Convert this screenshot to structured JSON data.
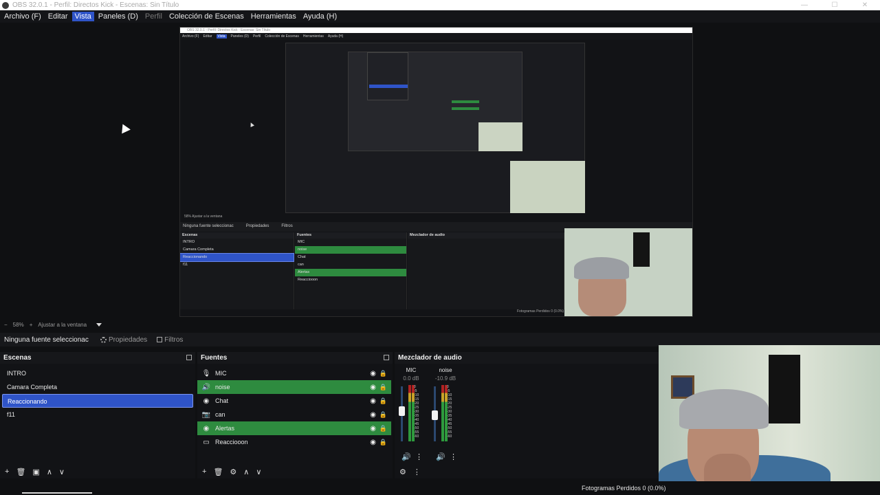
{
  "window": {
    "title": "OBS 32.0.1 - Perfil: Directos Kick - Escenas: Sin Título",
    "controls": [
      "—",
      "☐",
      "✕"
    ]
  },
  "menu": [
    {
      "label": "Archivo (F)",
      "state": "normal"
    },
    {
      "label": "Editar",
      "state": "normal"
    },
    {
      "label": "Vista",
      "state": "active"
    },
    {
      "label": "Paneles (D)",
      "state": "normal"
    },
    {
      "label": "Perfil",
      "state": "disabled"
    },
    {
      "label": "Colección de Escenas",
      "state": "normal"
    },
    {
      "label": "Herramientas",
      "state": "normal"
    },
    {
      "label": "Ayuda (H)",
      "state": "normal"
    }
  ],
  "nested_preview": {
    "title": "OBS 32.0.1 - Perfil: Directos Kick - Escenas: Sin Título",
    "menu": [
      "Archivo (F)",
      "Editar",
      "Vista",
      "Paneles (D)",
      "Perfil",
      "Colección de Escenas",
      "Herramientas",
      "Ayuda (H)"
    ],
    "zoom_text": "58%   Ajustar a la ventana",
    "source_row": [
      "Ninguna fuente seleccionac",
      "Propiedades",
      "Filtros"
    ],
    "scenes_header": "Escenas",
    "scenes": [
      "INTRO",
      "Camara Completa",
      "Reaccionando",
      "f11"
    ],
    "sources_header": "Fuentes",
    "sources": [
      "MIC",
      "noise",
      "Chat",
      "can",
      "Alertas",
      "Reacciooon"
    ],
    "mixer_header": "Mezclador de audio",
    "footer": "Fotogramas Perdidos 0 (0.0%)"
  },
  "zoom": {
    "value": "58%",
    "fit_label": "Ajustar a la ventana"
  },
  "source_toolbar": {
    "none_selected": "Ninguna fuente seleccionac",
    "properties": "Propiedades",
    "filters": "Filtros"
  },
  "scenes": {
    "header": "Escenas",
    "items": [
      {
        "label": "INTRO",
        "selected": false
      },
      {
        "label": "Camara Completa",
        "selected": false
      },
      {
        "label": "Reaccionando",
        "selected": true
      },
      {
        "label": "f11",
        "selected": false
      }
    ],
    "toolbar": [
      "+",
      "🗑",
      "▣",
      "∧",
      "∨"
    ]
  },
  "sources": {
    "header": "Fuentes",
    "items": [
      {
        "label": "MIC",
        "icon": "microphone-icon",
        "glyph": "🎙",
        "highlighted": false
      },
      {
        "label": "noise",
        "icon": "speaker-icon",
        "glyph": "🔊",
        "highlighted": true
      },
      {
        "label": "Chat",
        "icon": "browser-icon",
        "glyph": "◉",
        "highlighted": false
      },
      {
        "label": "can",
        "icon": "camera-icon",
        "glyph": "📷",
        "highlighted": false
      },
      {
        "label": "Alertas",
        "icon": "browser-icon",
        "glyph": "◉",
        "highlighted": true
      },
      {
        "label": "Reacciooon",
        "icon": "window-capture-icon",
        "glyph": "▭",
        "highlighted": false
      }
    ],
    "toolbar": [
      "+",
      "🗑",
      "⚙",
      "∧",
      "∨"
    ]
  },
  "mixer": {
    "header": "Mezclador de audio",
    "channels": [
      {
        "name": "MIC",
        "db": "0.0 dB",
        "level": 0.55
      },
      {
        "name": "noise",
        "db": "-10.9 dB",
        "level": 0.45
      }
    ],
    "scale": [
      "0",
      "-5",
      "-10",
      "-15",
      "-20",
      "-25",
      "-30",
      "-35",
      "-40",
      "-45",
      "-50",
      "-55",
      "-60"
    ],
    "footer": [
      "⚙",
      "⋮"
    ]
  },
  "status": {
    "frames_dropped": "Fotogramas Perdidos 0 (0.0%)",
    "progress": 0.08
  },
  "colors": {
    "accent_blue": "#2f54c8",
    "source_green": "#2e8b3f",
    "background": "#0f1012"
  }
}
